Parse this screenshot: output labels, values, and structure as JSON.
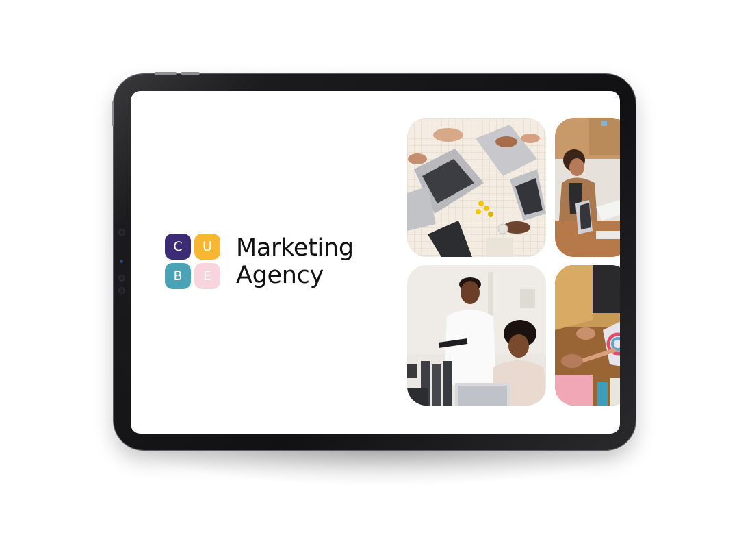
{
  "logo": {
    "tiles": [
      "C",
      "U",
      "B",
      "E"
    ],
    "tile_colors": [
      "#3b2c73",
      "#f7b733",
      "#4aa3b4",
      "#f8d5de"
    ],
    "title_line1": "Marketing",
    "title_line2": "Agency"
  },
  "colors": {
    "device_frame": "#111113",
    "screen_background": "#ffffff"
  }
}
